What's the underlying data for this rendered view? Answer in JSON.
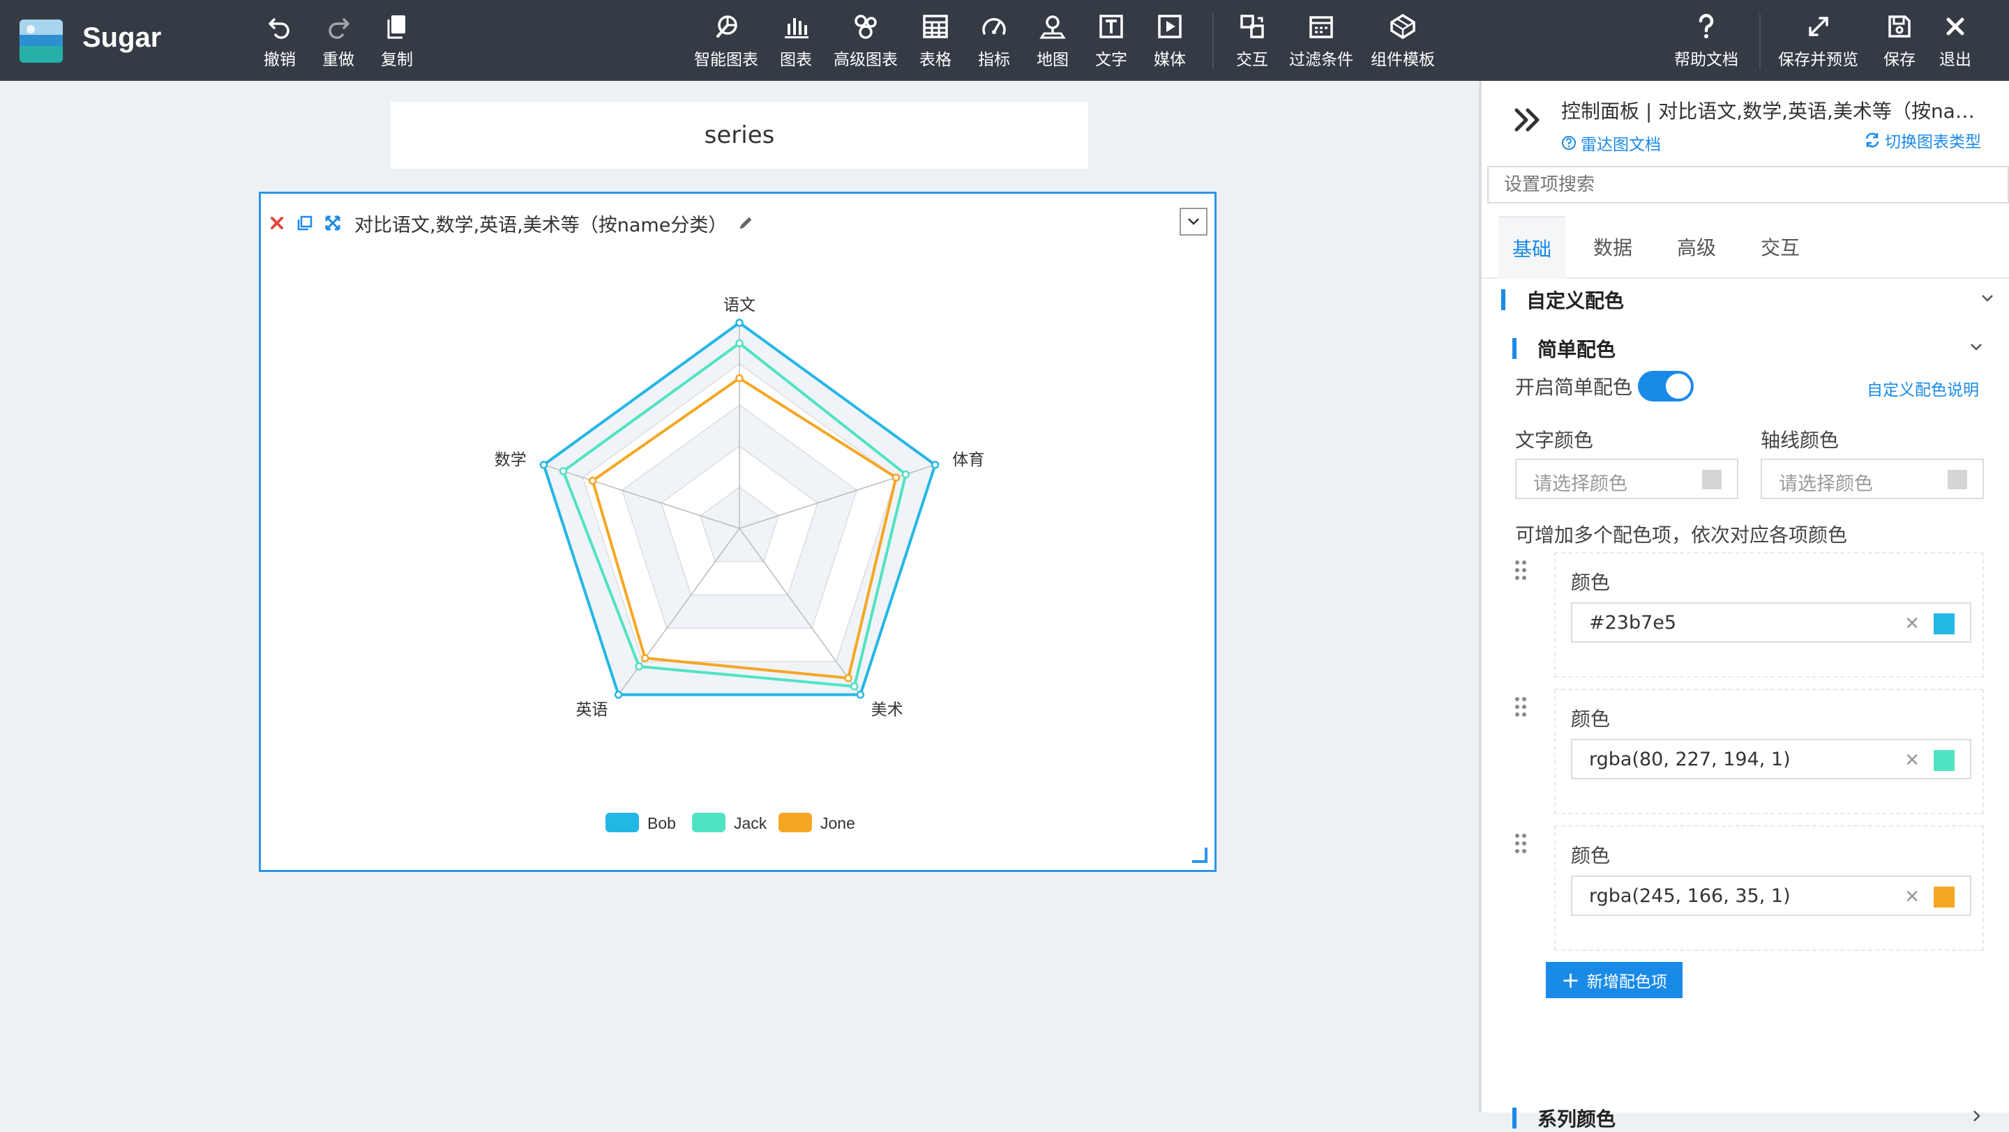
{
  "app": {
    "name": "Sugar"
  },
  "toolbar": {
    "left": [
      {
        "label": "撤销",
        "icon": "undo-icon"
      },
      {
        "label": "重做",
        "icon": "redo-icon"
      },
      {
        "label": "复制",
        "icon": "copy-icon"
      }
    ],
    "center": [
      {
        "label": "智能图表",
        "icon": "smart-chart-icon"
      },
      {
        "label": "图表",
        "icon": "bar-chart-icon"
      },
      {
        "label": "高级图表",
        "icon": "advanced-chart-icon"
      },
      {
        "label": "表格",
        "icon": "table-icon"
      },
      {
        "label": "指标",
        "icon": "gauge-icon"
      },
      {
        "label": "地图",
        "icon": "map-pin-icon"
      },
      {
        "label": "文字",
        "icon": "text-icon"
      },
      {
        "label": "媒体",
        "icon": "media-icon"
      },
      {
        "label": "交互",
        "icon": "interaction-icon"
      },
      {
        "label": "过滤条件",
        "icon": "filter-calendar-icon"
      },
      {
        "label": "组件模板",
        "icon": "template-icon"
      }
    ],
    "right": [
      {
        "label": "帮助文档",
        "icon": "help-icon"
      },
      {
        "label": "保存并预览",
        "icon": "expand-icon"
      },
      {
        "label": "保存",
        "icon": "save-icon"
      },
      {
        "label": "退出",
        "icon": "close-icon"
      }
    ]
  },
  "canvas": {
    "title_card": "series",
    "chart_card": {
      "title": "对比语文,数学,英语,美术等（按name分类）"
    }
  },
  "chart_data": {
    "type": "radar",
    "indicators": [
      "语文",
      "体育",
      "美术",
      "英语",
      "数学"
    ],
    "series": [
      {
        "name": "Bob",
        "color": "#23b7e5",
        "values": [
          100,
          100,
          100,
          100,
          100
        ]
      },
      {
        "name": "Jack",
        "color": "#50e3c2",
        "values": [
          90,
          85,
          95,
          83,
          90
        ]
      },
      {
        "name": "Jone",
        "color": "#f5a623",
        "values": [
          73,
          80,
          90,
          78,
          75
        ]
      }
    ],
    "max": 100,
    "legend_position": "bottom-center",
    "split_area_colors": [
      "#f0f3f8",
      "#ffffff"
    ]
  },
  "panel": {
    "title": "控制面板 | 对比语文,数学,英语,美术等（按name...",
    "doc_link": "雷达图文档",
    "switch_link": "切换图表类型",
    "search_placeholder": "设置项搜索",
    "tabs": [
      "基础",
      "数据",
      "高级",
      "交互"
    ],
    "section_custom": "自定义配色",
    "section_simple": "简单配色",
    "enable_simple": "开启简单配色",
    "enable_simple_on": true,
    "custom_color_help": "自定义配色说明",
    "text_color_label": "文字颜色",
    "axis_color_label": "轴线颜色",
    "color_placeholder": "请选择颜色",
    "hint": "可增加多个配色项，依次对应各项颜色",
    "color_items": [
      {
        "label": "颜色",
        "value": "#23b7e5",
        "swatch": "#23b7e5"
      },
      {
        "label": "颜色",
        "value": "rgba(80, 227, 194, 1)",
        "swatch": "#50e3c2"
      },
      {
        "label": "颜色",
        "value": "rgba(245, 166, 35, 1)",
        "swatch": "#f5a623"
      }
    ],
    "add_button": "新增配色项",
    "section_series": "系列颜色"
  }
}
